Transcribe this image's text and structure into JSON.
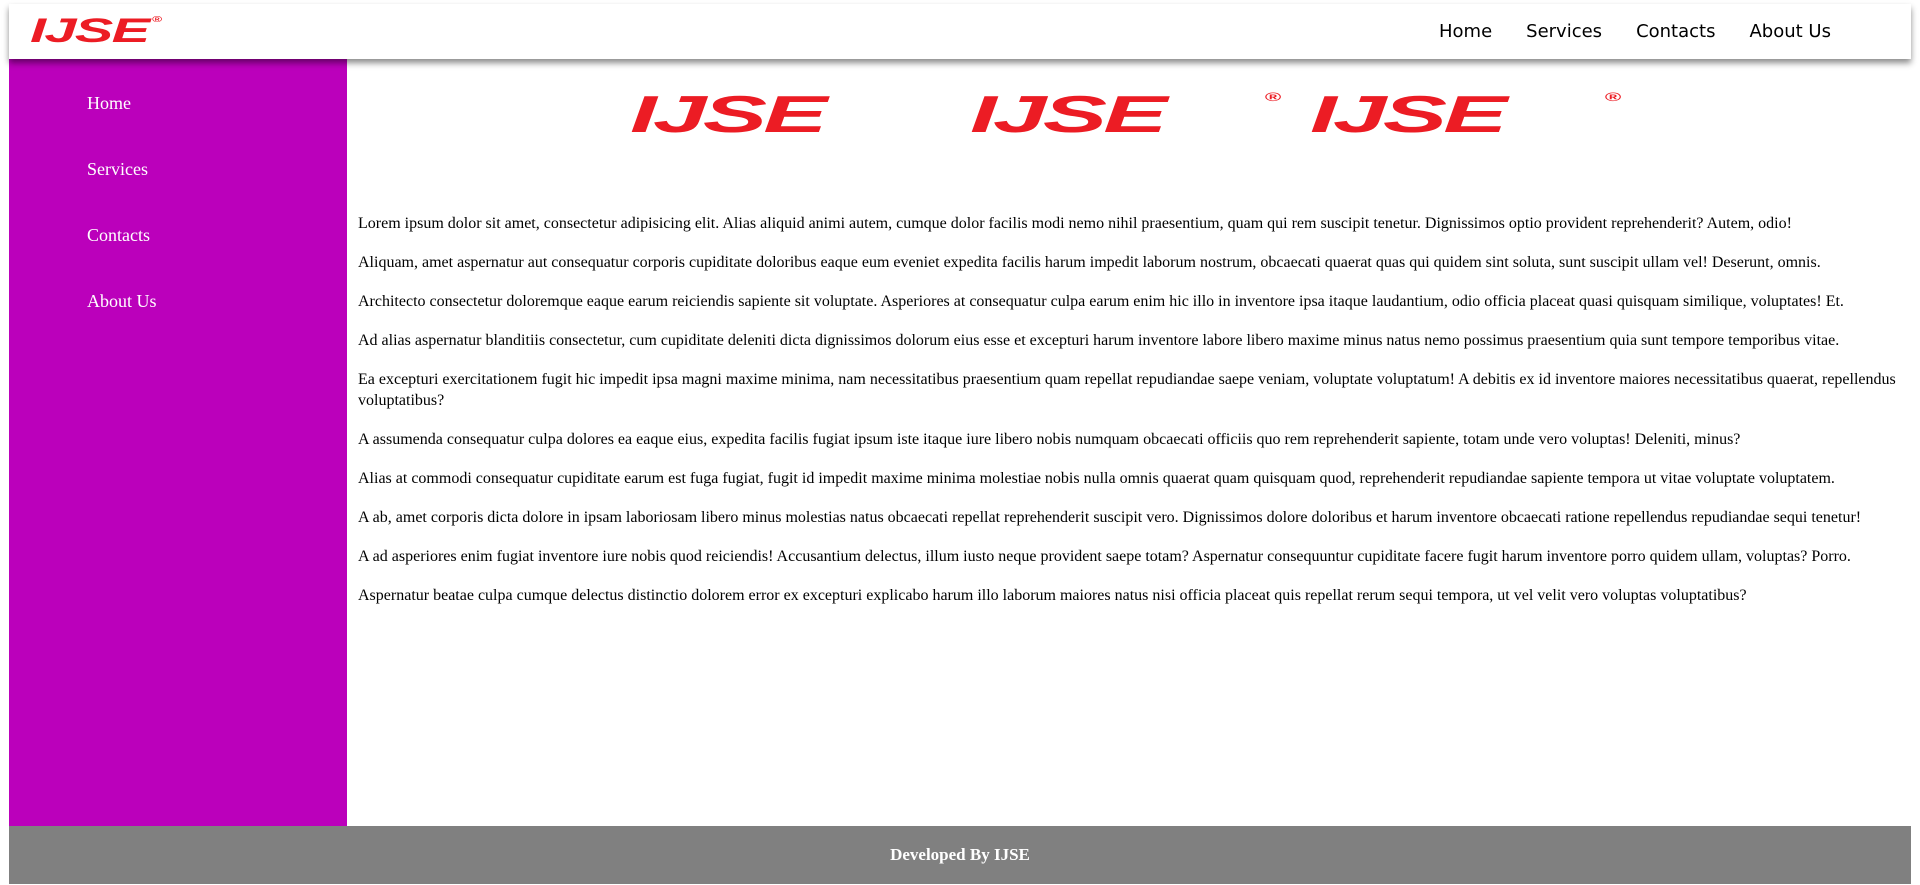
{
  "header": {
    "logo_text": "IJSE",
    "logo_registered": "®",
    "nav": [
      {
        "label": "Home"
      },
      {
        "label": "Services"
      },
      {
        "label": "Contacts"
      },
      {
        "label": "About Us"
      }
    ]
  },
  "sidebar": {
    "items": [
      {
        "label": "Home"
      },
      {
        "label": "Services"
      },
      {
        "label": "Contacts"
      },
      {
        "label": "About Us"
      }
    ]
  },
  "main": {
    "banner_logos": [
      "IJSE",
      "IJSE",
      "IJSE"
    ],
    "paragraphs": [
      "Lorem ipsum dolor sit amet, consectetur adipisicing elit. Alias aliquid animi autem, cumque dolor facilis modi nemo nihil praesentium, quam qui rem suscipit tenetur. Dignissimos optio provident reprehenderit? Autem, odio!",
      "Aliquam, amet aspernatur aut consequatur corporis cupiditate doloribus eaque eum eveniet expedita facilis harum impedit laborum nostrum, obcaecati quaerat quas qui quidem sint soluta, sunt suscipit ullam vel! Deserunt, omnis.",
      "Architecto consectetur doloremque eaque earum reiciendis sapiente sit voluptate. Asperiores at consequatur culpa earum enim hic illo in inventore ipsa itaque laudantium, odio officia placeat quasi quisquam similique, voluptates! Et.",
      "Ad alias aspernatur blanditiis consectetur, cum cupiditate deleniti dicta dignissimos dolorum eius esse et excepturi harum inventore labore libero maxime minus natus nemo possimus praesentium quia sunt tempore temporibus vitae.",
      "Ea excepturi exercitationem fugit hic impedit ipsa magni maxime minima, nam necessitatibus praesentium quam repellat repudiandae saepe veniam, voluptate voluptatum! A debitis ex id inventore maiores necessitatibus quaerat, repellendus voluptatibus?",
      "A assumenda consequatur culpa dolores ea eaque eius, expedita facilis fugiat ipsum iste itaque iure libero nobis numquam obcaecati officiis quo rem reprehenderit sapiente, totam unde vero voluptas! Deleniti, minus?",
      "Alias at commodi consequatur cupiditate earum est fuga fugiat, fugit id impedit maxime minima molestiae nobis nulla omnis quaerat quam quisquam quod, reprehenderit repudiandae sapiente tempora ut vitae voluptate voluptatem.",
      "A ab, amet corporis dicta dolore in ipsam laboriosam libero minus molestias natus obcaecati repellat reprehenderit suscipit vero. Dignissimos dolore doloribus et harum inventore obcaecati ratione repellendus repudiandae sequi tenetur!",
      "A ad asperiores enim fugiat inventore iure nobis quod reiciendis! Accusantium delectus, illum iusto neque provident saepe totam? Aspernatur consequuntur cupiditate facere fugit harum inventore porro quidem ullam, voluptas? Porro.",
      "Aspernatur beatae culpa cumque delectus distinctio dolorem error ex excepturi explicabo harum illo laborum maiores natus nisi officia placeat quis repellat rerum sequi tempora, ut vel velit vero voluptas voluptatibus?"
    ]
  },
  "footer": {
    "text": "Developed By IJSE"
  },
  "colors": {
    "brand_red": "#ec1c24",
    "sidebar_bg": "#bb00bb",
    "footer_bg": "#808080"
  }
}
